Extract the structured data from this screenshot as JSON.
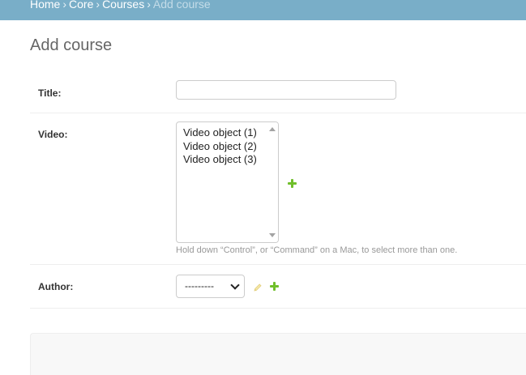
{
  "breadcrumbs": {
    "items": [
      {
        "label": "Home"
      },
      {
        "label": "Core"
      },
      {
        "label": "Courses"
      }
    ],
    "separator": "›",
    "current": "Add course"
  },
  "page": {
    "title": "Add course"
  },
  "form": {
    "title_field": {
      "label": "Title:",
      "value": ""
    },
    "video_field": {
      "label": "Video:",
      "options": [
        "Video object (1)",
        "Video object (2)",
        "Video object (3)"
      ],
      "help_text": "Hold down “Control”, or “Command” on a Mac, to select more than one."
    },
    "author_field": {
      "label": "Author:",
      "selected": "---------"
    }
  },
  "colors": {
    "header_bg": "#79aec8",
    "add_green": "#70bf2b",
    "submit_bg": "#f8f8f8"
  },
  "icons": {
    "add_video": "add-icon",
    "change_author": "pencil-icon",
    "add_author": "add-icon"
  }
}
